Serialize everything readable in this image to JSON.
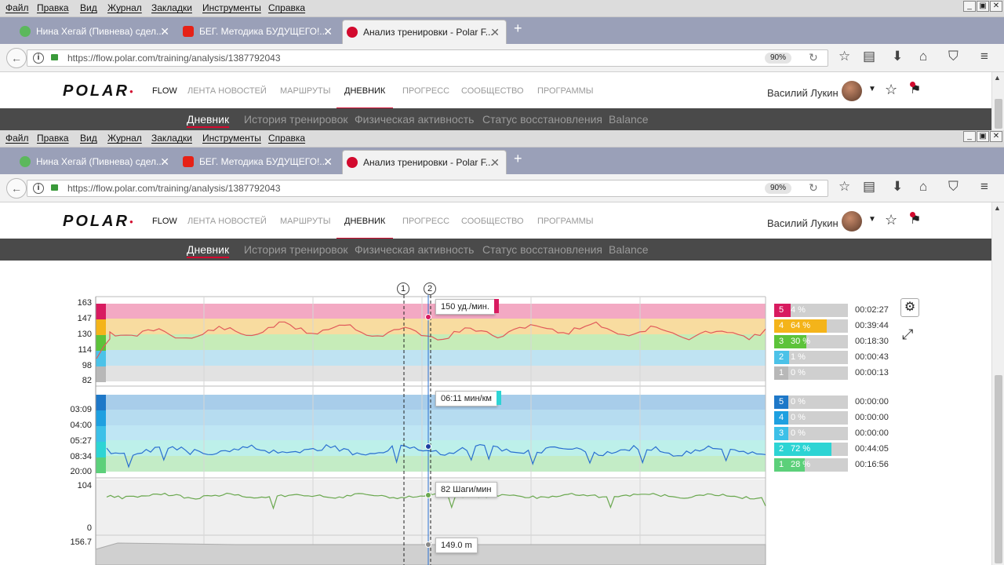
{
  "menu": [
    "Файл",
    "Правка",
    "Вид",
    "Журнал",
    "Закладки",
    "Инструменты",
    "Справка"
  ],
  "window_controls": [
    "_",
    "▣",
    "✕"
  ],
  "tabs": [
    {
      "title": "Нина Хегай (Пивнева) сдел...",
      "icon_color": "#5cb85c"
    },
    {
      "title": "БЕГ. Методика БУДУЩЕГО!...",
      "icon_color": "#e62117"
    },
    {
      "title": "Анализ тренировки - Polar F...",
      "icon_color": "#d20a2e"
    }
  ],
  "new_tab": "+",
  "tab_close": "✕",
  "address": {
    "url": "https://flow.polar.com/training/analysis/1387792043",
    "zoom": "90%",
    "info": "i"
  },
  "toolbar_icons": [
    "☆",
    "▤",
    "⬇",
    "⌂",
    "⛉",
    "≡"
  ],
  "polar": {
    "logo": "POLAR",
    "logo_accent": "●",
    "flow": "FLOW",
    "nav": [
      "ЛЕНТА НОВОСТЕЙ",
      "МАРШРУТЫ",
      "ДНЕВНИК",
      "ПРОГРЕСС",
      "СООБЩЕСТВО",
      "ПРОГРАММЫ"
    ],
    "active_nav": "ДНЕВНИК",
    "user": "Василий Лукин",
    "subnav": [
      "Дневник",
      "История тренировок",
      "Физическая активность",
      "Статус восстановления",
      "Balance"
    ],
    "active_subnav": "Дневник",
    "brand_color": "#d20a2e"
  },
  "analysis": {
    "markers": [
      "1",
      "2"
    ],
    "hr": {
      "axis": [
        "163",
        "147",
        "130",
        "114",
        "98",
        "82"
      ],
      "tooltip": "150 уд./мин.",
      "zones": [
        {
          "zone": "5",
          "pct": "4 %",
          "fill": 0.04,
          "time": "00:02:27",
          "color": "#d81b60"
        },
        {
          "zone": "4",
          "pct": "64 %",
          "fill": 0.64,
          "time": "00:39:44",
          "color": "#f4b41a"
        },
        {
          "zone": "3",
          "pct": "30 %",
          "fill": 0.3,
          "time": "00:18:30",
          "color": "#5cc33a"
        },
        {
          "zone": "2",
          "pct": "1 %",
          "fill": 0.01,
          "time": "00:00:43",
          "color": "#4cc2e8"
        },
        {
          "zone": "1",
          "pct": "0 %",
          "fill": 0.0,
          "time": "00:00:13",
          "color": "#b8b8b8"
        }
      ]
    },
    "pace": {
      "axis": [
        "03:09",
        "04:00",
        "05:27",
        "08:34",
        "20:00"
      ],
      "tooltip": "06:11 мин/км",
      "zones": [
        {
          "zone": "5",
          "pct": "0 %",
          "fill": 0.0,
          "time": "00:00:00",
          "color": "#1e78c8"
        },
        {
          "zone": "4",
          "pct": "0 %",
          "fill": 0.0,
          "time": "00:00:00",
          "color": "#1ea0e0"
        },
        {
          "zone": "3",
          "pct": "0 %",
          "fill": 0.0,
          "time": "00:00:00",
          "color": "#3cc0e8"
        },
        {
          "zone": "2",
          "pct": "72 %",
          "fill": 0.72,
          "time": "00:44:05",
          "color": "#2dd4d4"
        },
        {
          "zone": "1",
          "pct": "28 %",
          "fill": 0.28,
          "time": "00:16:56",
          "color": "#5cd07a"
        }
      ]
    },
    "cadence": {
      "axis": [
        "104",
        "0"
      ],
      "tooltip": "82 Шаги/мин"
    },
    "altitude": {
      "axis": [
        "156.7"
      ],
      "tooltip": "149.0 m"
    },
    "gear_icon": "⚙",
    "expand_icon": "⤢"
  }
}
